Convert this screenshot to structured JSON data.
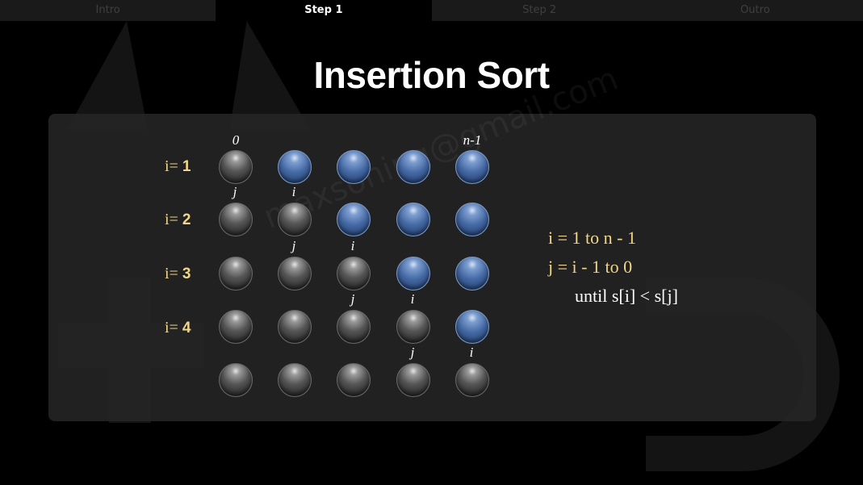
{
  "tabs": [
    {
      "label": "Intro",
      "active": false
    },
    {
      "label": "Step 1",
      "active": true
    },
    {
      "label": "Step 2",
      "active": false
    },
    {
      "label": "Outro",
      "active": false
    }
  ],
  "title": "Insertion Sort",
  "watermark": "maxsoning@gmail.com",
  "row_labels": [
    {
      "prefix": "i= ",
      "value": "1"
    },
    {
      "prefix": "i= ",
      "value": "2"
    },
    {
      "prefix": "i= ",
      "value": "3"
    },
    {
      "prefix": "i= ",
      "value": "4"
    }
  ],
  "index_labels": {
    "first": "0",
    "last": "n-1"
  },
  "rows": [
    {
      "balls": [
        "gray",
        "blue",
        "blue",
        "blue",
        "blue"
      ],
      "markers": []
    },
    {
      "balls": [
        "gray",
        "gray",
        "blue",
        "blue",
        "blue"
      ],
      "markers": [
        {
          "col": 0,
          "text": "j"
        },
        {
          "col": 1,
          "text": "i"
        }
      ]
    },
    {
      "balls": [
        "gray",
        "gray",
        "gray",
        "blue",
        "blue"
      ],
      "markers": [
        {
          "col": 1,
          "text": "j"
        },
        {
          "col": 2,
          "text": "i"
        }
      ]
    },
    {
      "balls": [
        "gray",
        "gray",
        "gray",
        "gray",
        "blue"
      ],
      "markers": [
        {
          "col": 2,
          "text": "j"
        },
        {
          "col": 3,
          "text": "i"
        }
      ]
    },
    {
      "balls": [
        "gray",
        "gray",
        "gray",
        "gray",
        "gray"
      ],
      "markers": [
        {
          "col": 3,
          "text": "j"
        },
        {
          "col": 4,
          "text": "i"
        }
      ]
    }
  ],
  "algorithm": {
    "line1": "i = 1 to n - 1",
    "line2": "j = i - 1 to 0",
    "line3": "until s[i] < s[j]"
  },
  "colors": {
    "gray_ball": "#5a5a5a",
    "blue_ball": "#4468a3",
    "label_yellow": "#f0d58a"
  }
}
